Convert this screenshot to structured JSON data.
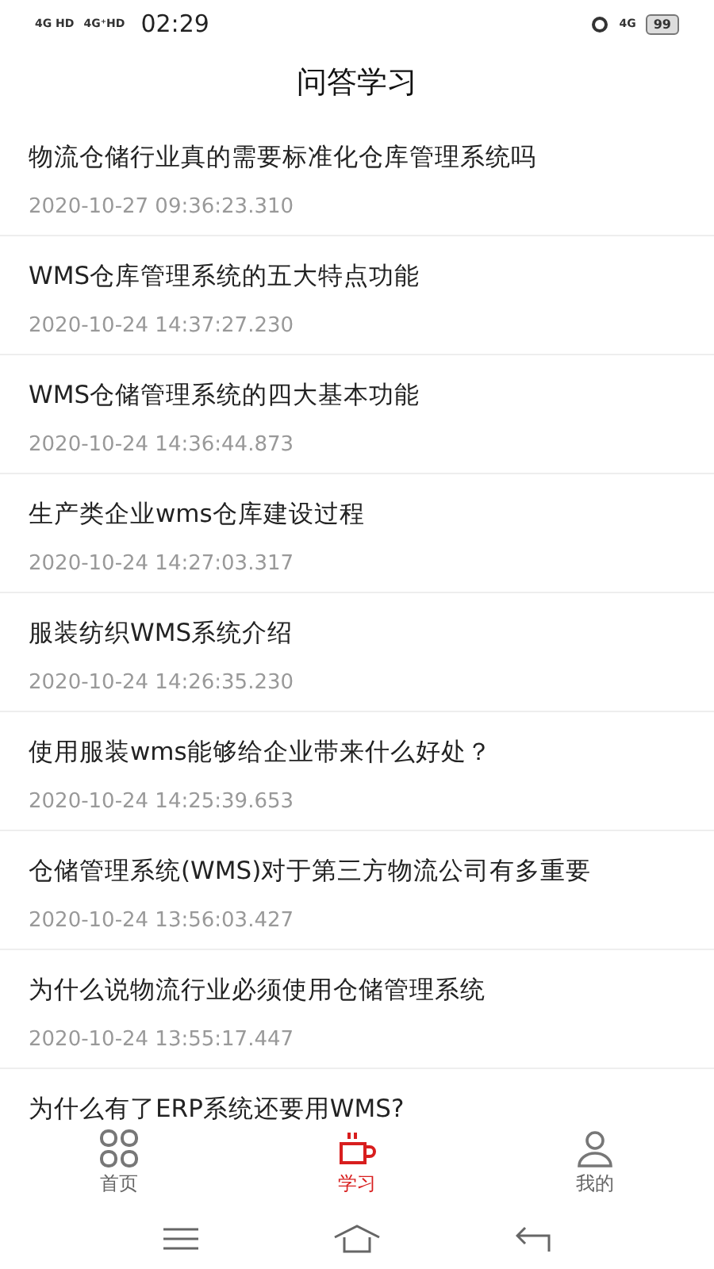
{
  "status_bar": {
    "networks": [
      "4G HD",
      "4G⁺HD"
    ],
    "time": "02:29",
    "right_network": "4G",
    "battery": "99"
  },
  "title": "问答学习",
  "articles": [
    {
      "title": "物流仓储行业真的需要标准化仓库管理系统吗",
      "date": "2020-10-27 09:36:23.310"
    },
    {
      "title": "WMS仓库管理系统的五大特点功能",
      "date": "2020-10-24 14:37:27.230"
    },
    {
      "title": "WMS仓储管理系统的四大基本功能",
      "date": "2020-10-24 14:36:44.873"
    },
    {
      "title": "生产类企业wms仓库建设过程",
      "date": "2020-10-24 14:27:03.317"
    },
    {
      "title": "服装纺织WMS系统介绍",
      "date": "2020-10-24 14:26:35.230"
    },
    {
      "title": "使用服装wms能够给企业带来什么好处？",
      "date": "2020-10-24 14:25:39.653"
    },
    {
      "title": "仓储管理系统(WMS)对于第三方物流公司有多重要",
      "date": "2020-10-24 13:56:03.427"
    },
    {
      "title": "为什么说物流行业必须使用仓储管理系统",
      "date": "2020-10-24 13:55:17.447"
    },
    {
      "title": "为什么有了ERP系统还要用WMS?"
    }
  ],
  "tabs": [
    {
      "label": "首页",
      "kind": "home",
      "selected": false
    },
    {
      "label": "学习",
      "kind": "study",
      "selected": true
    },
    {
      "label": "我的",
      "kind": "me",
      "selected": false
    }
  ]
}
